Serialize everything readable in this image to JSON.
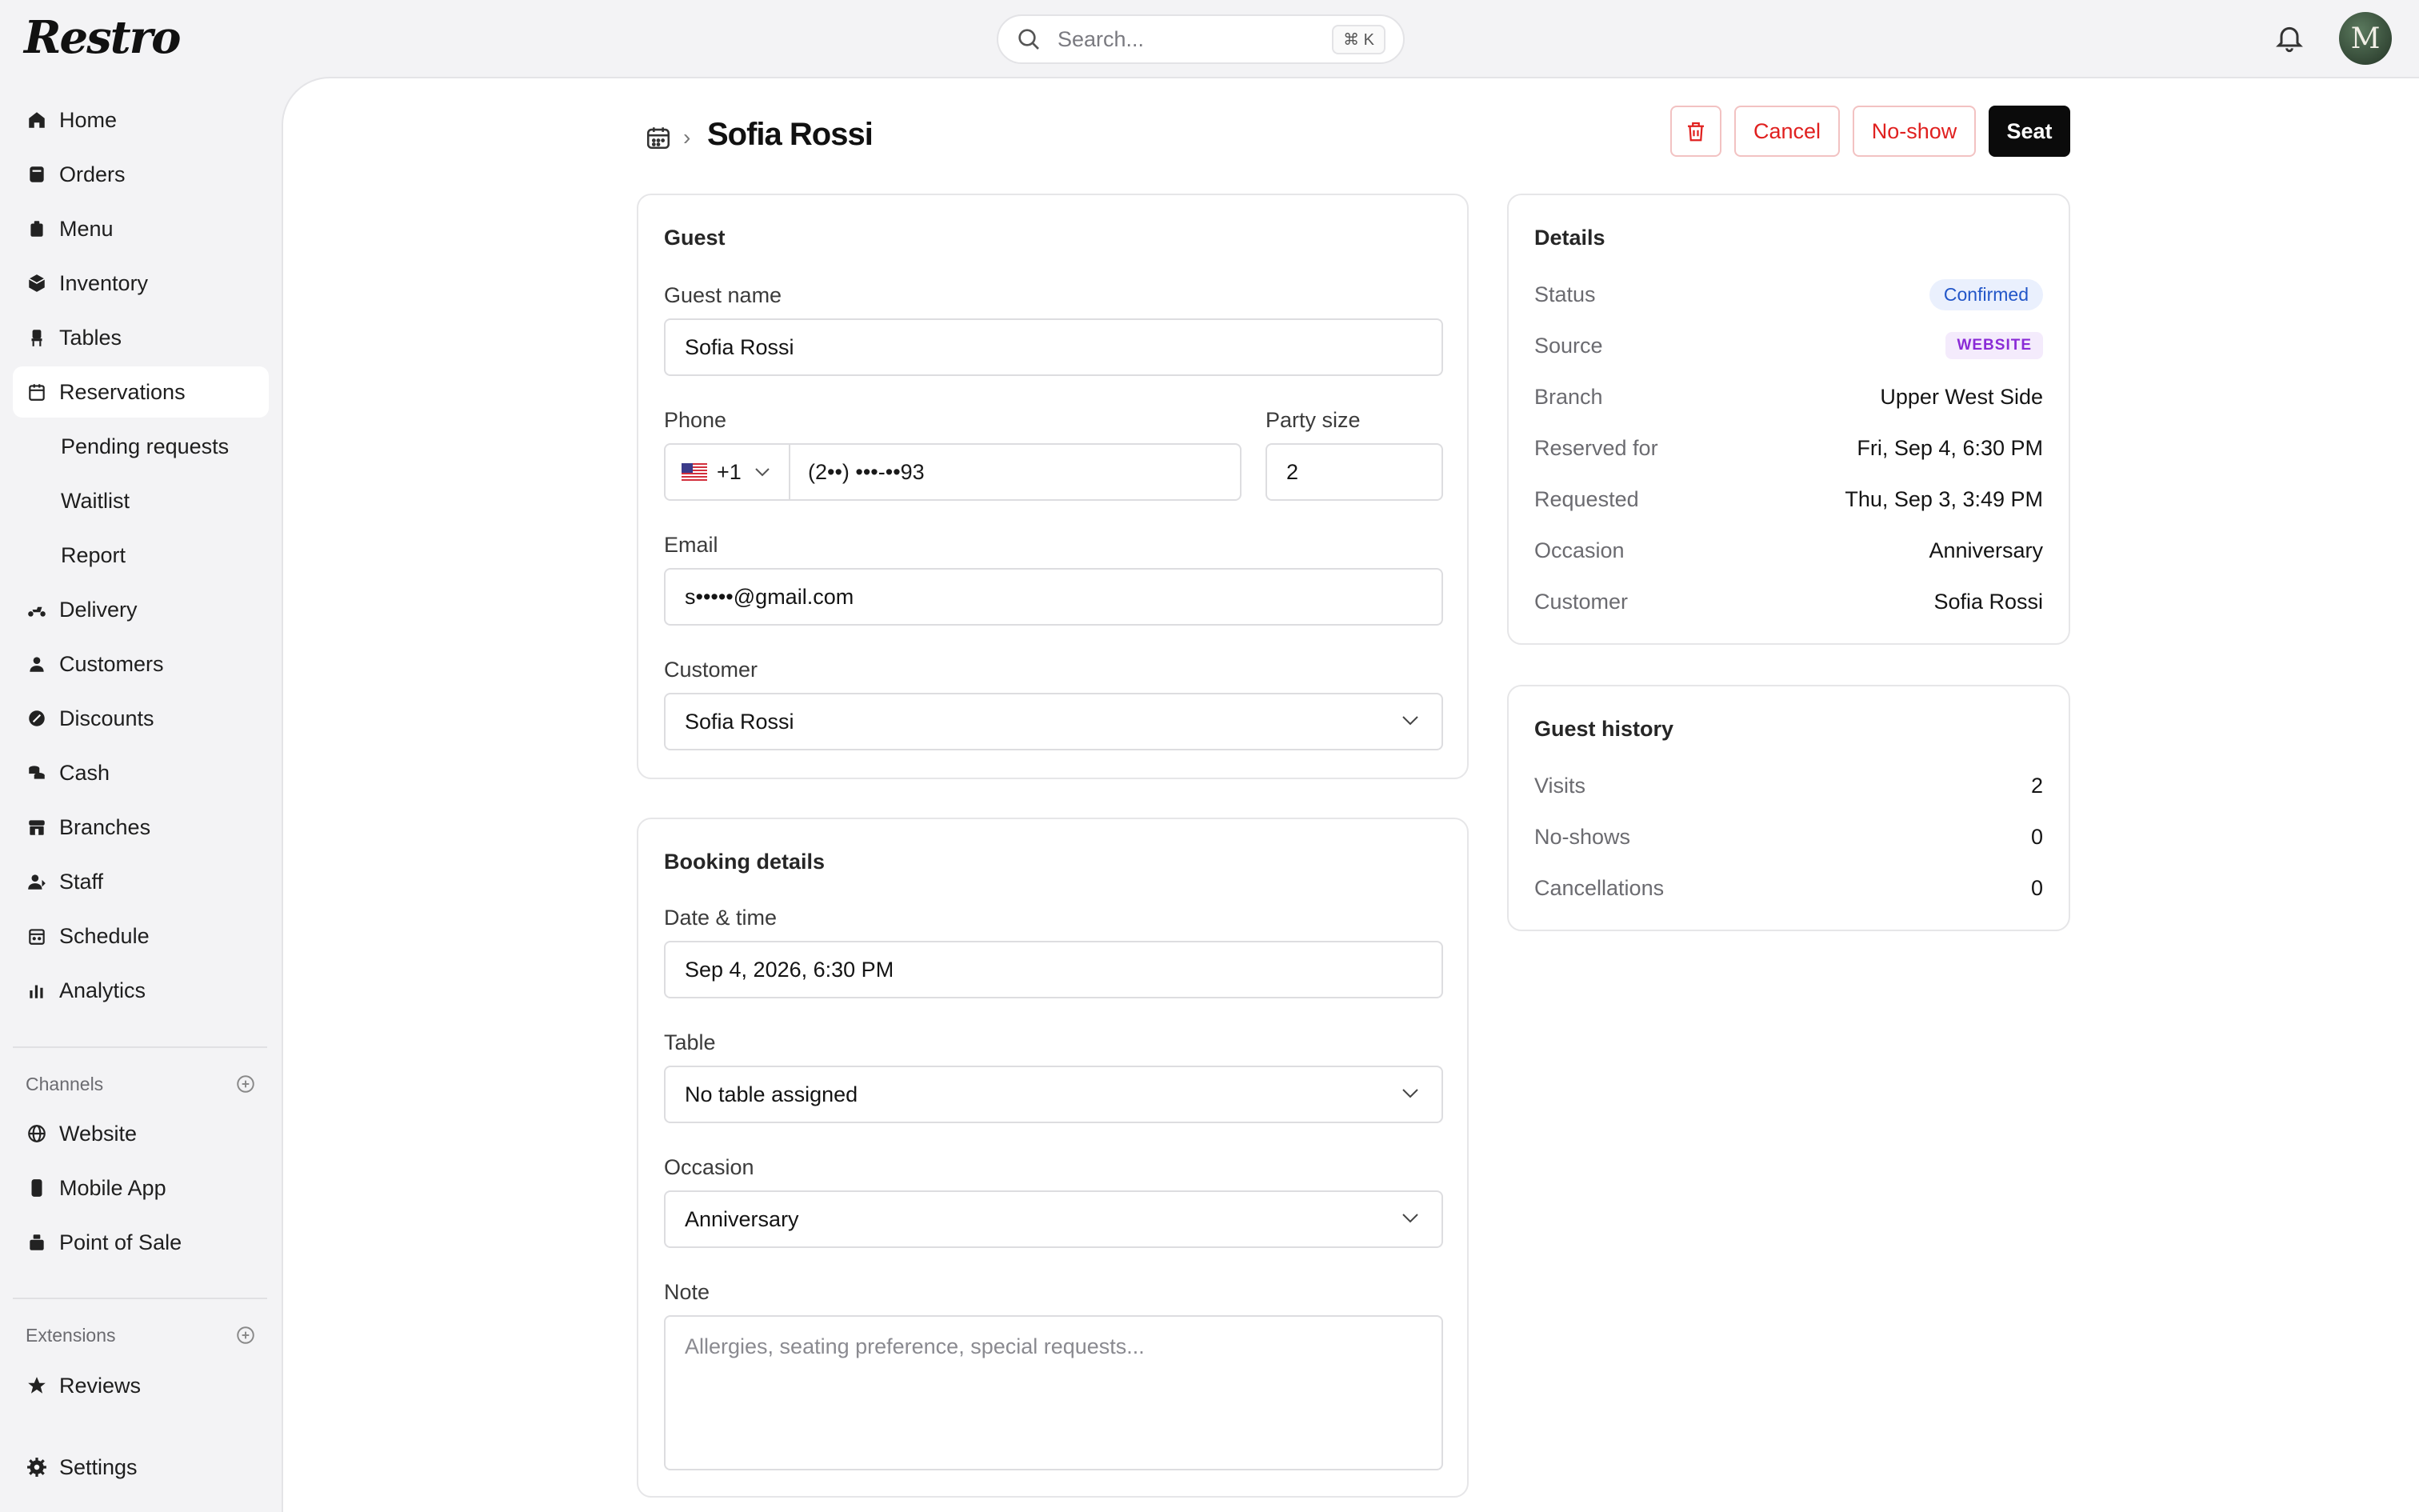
{
  "app": {
    "logo": "Restro"
  },
  "search": {
    "placeholder": "Search...",
    "shortcut": "⌘ K"
  },
  "user": {
    "avatar_initial": "M"
  },
  "sidebar": {
    "items": [
      {
        "label": "Home",
        "icon": "home-icon"
      },
      {
        "label": "Orders",
        "icon": "orders-icon"
      },
      {
        "label": "Menu",
        "icon": "menu-icon"
      },
      {
        "label": "Inventory",
        "icon": "inventory-icon"
      },
      {
        "label": "Tables",
        "icon": "chair-icon"
      },
      {
        "label": "Reservations",
        "icon": "calendar-icon",
        "active": true
      },
      {
        "label": "Pending requests"
      },
      {
        "label": "Waitlist"
      },
      {
        "label": "Report"
      },
      {
        "label": "Delivery",
        "icon": "scooter-icon"
      },
      {
        "label": "Customers",
        "icon": "person-icon"
      },
      {
        "label": "Discounts",
        "icon": "discount-icon"
      },
      {
        "label": "Cash",
        "icon": "coins-icon"
      },
      {
        "label": "Branches",
        "icon": "store-icon"
      },
      {
        "label": "Staff",
        "icon": "staff-icon"
      },
      {
        "label": "Schedule",
        "icon": "schedule-icon"
      },
      {
        "label": "Analytics",
        "icon": "analytics-icon"
      }
    ],
    "channels_label": "Channels",
    "channels": [
      {
        "label": "Website",
        "icon": "globe-icon"
      },
      {
        "label": "Mobile App",
        "icon": "phone-icon"
      },
      {
        "label": "Point of Sale",
        "icon": "pos-icon"
      }
    ],
    "extensions_label": "Extensions",
    "extensions": [
      {
        "label": "Reviews",
        "icon": "star-icon"
      }
    ],
    "settings": {
      "label": "Settings",
      "icon": "gear-icon"
    }
  },
  "page": {
    "title": "Sofia Rossi",
    "actions": {
      "cancel": "Cancel",
      "no_show": "No-show",
      "seat": "Seat"
    }
  },
  "guest": {
    "title": "Guest",
    "name_label": "Guest name",
    "name_value": "Sofia Rossi",
    "phone_label": "Phone",
    "phone_country_code": "+1",
    "phone_value": "(2••) •••-••93",
    "party_label": "Party size",
    "party_value": "2",
    "email_label": "Email",
    "email_value": "s•••••@gmail.com",
    "customer_label": "Customer",
    "customer_value": "Sofia Rossi"
  },
  "booking": {
    "title": "Booking details",
    "datetime_label": "Date & time",
    "datetime_value": "Sep 4, 2026, 6:30 PM",
    "table_label": "Table",
    "table_value": "No table assigned",
    "occasion_label": "Occasion",
    "occasion_value": "Anniversary",
    "note_label": "Note",
    "note_placeholder": "Allergies, seating preference, special requests..."
  },
  "details": {
    "title": "Details",
    "status_label": "Status",
    "status_value": "Confirmed",
    "source_label": "Source",
    "source_value": "WEBSITE",
    "branch_label": "Branch",
    "branch_value": "Upper West Side",
    "reserved_label": "Reserved for",
    "reserved_value": "Fri, Sep 4, 6:30 PM",
    "requested_label": "Requested",
    "requested_value": "Thu, Sep 3, 3:49 PM",
    "occasion_label": "Occasion",
    "occasion_value": "Anniversary",
    "customer_label": "Customer",
    "customer_value": "Sofia Rossi"
  },
  "history": {
    "title": "Guest history",
    "visits_label": "Visits",
    "visits_value": "2",
    "noshows_label": "No-shows",
    "noshows_value": "0",
    "cancellations_label": "Cancellations",
    "cancellations_value": "0"
  },
  "colors": {
    "danger": "#e0201f",
    "primary": "#0b0b0b",
    "status_blue": "#2256c8",
    "source_purple": "#8a2bd6"
  }
}
